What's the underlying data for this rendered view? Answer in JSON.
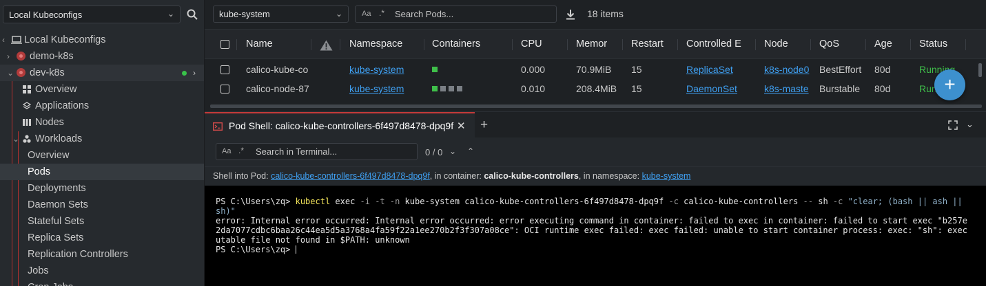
{
  "sidebar": {
    "kubeconfig_select": "Local Kubeconfigs",
    "tree": {
      "root": "Local Kubeconfigs",
      "clusters": [
        "demo-k8s",
        "dev-k8s"
      ],
      "items": {
        "overview": "Overview",
        "applications": "Applications",
        "nodes": "Nodes",
        "workloads": "Workloads",
        "wl_overview": "Overview",
        "pods": "Pods",
        "deployments": "Deployments",
        "daemon_sets": "Daemon Sets",
        "stateful_sets": "Stateful Sets",
        "replica_sets": "Replica Sets",
        "replication_controllers": "Replication Controllers",
        "jobs": "Jobs",
        "cron_jobs": "Cron Jobs"
      }
    }
  },
  "toolbar": {
    "namespace": "kube-system",
    "search_placeholder": "Search Pods...",
    "case_label": "Aa",
    "regex_label": ".*",
    "items_count": "18 items"
  },
  "table": {
    "columns": [
      "Name",
      "Namespace",
      "Containers",
      "CPU",
      "Memor",
      "Restart",
      "Controlled E",
      "Node",
      "QoS",
      "Age",
      "Status"
    ],
    "rows": [
      {
        "name": "calico-kube-co",
        "namespace": "kube-system",
        "cpu": "0.000",
        "memory": "70.9MiB",
        "restarts": "15",
        "controlled_by": "ReplicaSet",
        "node": "k8s-node0",
        "qos": "BestEffort",
        "age": "80d",
        "status": "Running",
        "containers": [
          "#3fbf4a"
        ]
      },
      {
        "name": "calico-node-87",
        "namespace": "kube-system",
        "cpu": "0.010",
        "memory": "208.4MiB",
        "restarts": "15",
        "controlled_by": "DaemonSet",
        "node": "k8s-maste",
        "qos": "Burstable",
        "age": "80d",
        "status": "Running",
        "containers": [
          "#3fbf4a",
          "#7a7f85",
          "#7a7f85",
          "#7a7f85"
        ]
      }
    ]
  },
  "dock": {
    "tab_title": "Pod Shell: calico-kube-controllers-6f497d8478-dpq9f",
    "term_search_placeholder": "Search in Terminal...",
    "term_case_label": "Aa",
    "term_regex_label": ".*",
    "match_count": "0 / 0",
    "shell_info": {
      "prefix": "Shell into Pod: ",
      "pod": "calico-kube-controllers-6f497d8478-dpq9f",
      "mid1": ", in container: ",
      "container": "calico-kube-controllers",
      "mid2": ", in namespace: ",
      "namespace": "kube-system"
    },
    "terminal": {
      "prompt": "PS C:\\Users\\zq> ",
      "cmd_word": "kubectl",
      "cmd_exec": " exec ",
      "flag_it": "-i -t -n",
      "cmd_ns": " kube-system calico-kube-controllers-6f497d8478-dpq9f ",
      "flag_c": "-c",
      "cmd_cont": " calico-kube-controllers ",
      "flag_dd": "--",
      "cmd_sh": " sh ",
      "flag_c2": "-c",
      "str_part1": " \"clear; (bash || ash ||",
      "str_part2": "sh)\"",
      "error_lines": [
        "error: Internal error occurred: Internal error occurred: error executing command in container: failed to exec in container: failed to start exec \"b257e",
        "2da7077cdbc6baa26c44ea5d5a3768a4fa59f22a1ee270b2f3f307a08ce\": OCI runtime exec failed: exec failed: unable to start container process: exec: \"sh\": exec",
        "utable file not found in $PATH: unknown"
      ],
      "final_prompt": "PS C:\\Users\\zq> "
    }
  }
}
